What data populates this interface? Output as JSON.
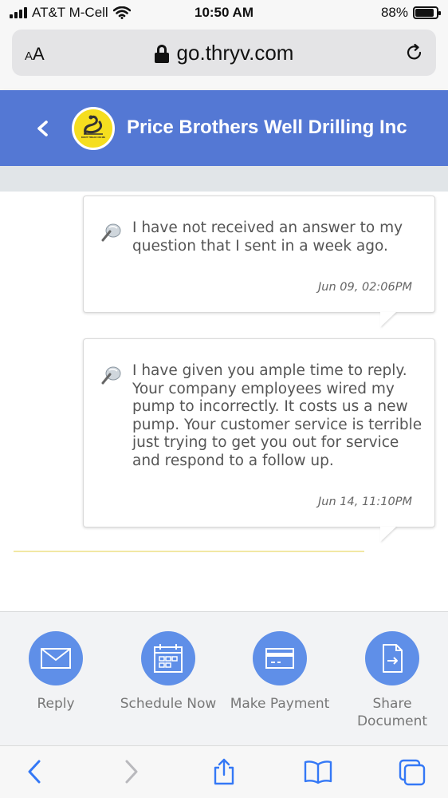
{
  "status_bar": {
    "carrier": "AT&T M-Cell",
    "time": "10:50 AM",
    "battery": "88%",
    "battery_level": 0.88
  },
  "browser": {
    "aa_label": "AA",
    "url": "go.thryv.com"
  },
  "header": {
    "title": "Price Brothers Well Drilling Inc",
    "logo_text": "DONT TREAD ON ME",
    "color": "#5478d4"
  },
  "messages": [
    {
      "text": "I have not received an answer to my question that I sent in a week ago.",
      "time": "Jun 09, 02:06PM"
    },
    {
      "text": "I have given you ample time to reply. Your company employees wired my pump to incorrectly. It costs us a new pump. Your customer service is terrible just trying to get you out for service and respond to a follow up.",
      "time": "Jun 14, 11:10PM"
    }
  ],
  "actions": [
    {
      "label": "Reply",
      "icon": "mail-icon"
    },
    {
      "label": "Schedule Now",
      "icon": "calendar-icon"
    },
    {
      "label": "Make Payment",
      "icon": "credit-card-icon"
    },
    {
      "label": "Share Document",
      "icon": "document-share-icon"
    }
  ],
  "accent_color": "#5f8fe8"
}
